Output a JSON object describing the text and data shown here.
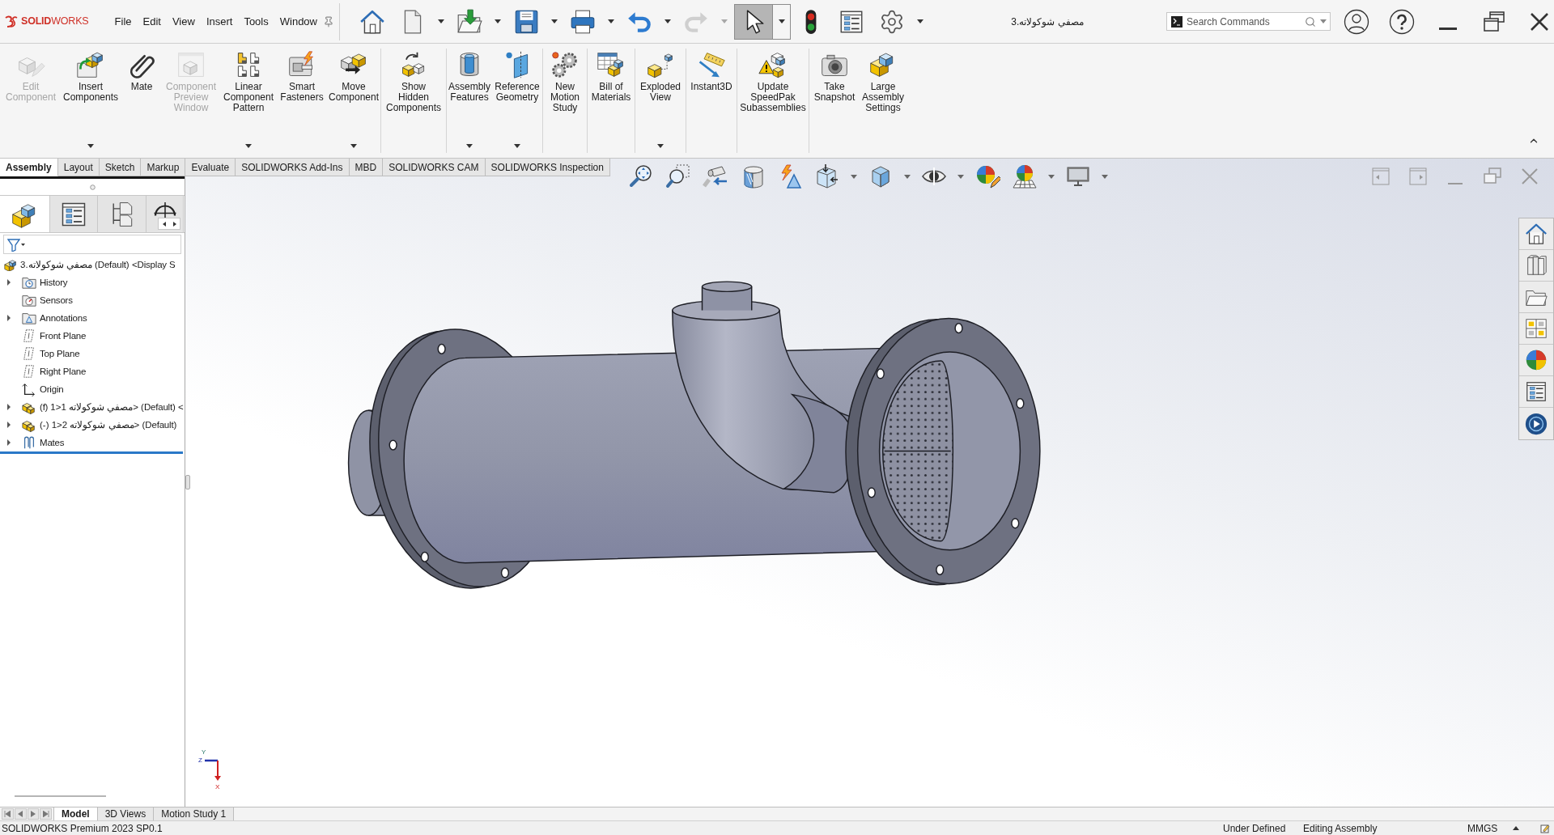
{
  "title_bar": {
    "logo": "**SOLID**WORKS",
    "menu": [
      "File",
      "Edit",
      "View",
      "Insert",
      "Tools",
      "Window"
    ],
    "quick_access": {
      "redo": {
        "disabled": true
      },
      "select": {
        "selected": true
      }
    },
    "document_title": "3.مصفي شوكولاته",
    "search": {
      "placeholder": "Search Commands"
    }
  },
  "ribbon": {
    "groups": [
      [
        {
          "label": "Edit\nComponent",
          "disabled": true,
          "dropdown": false
        },
        {
          "label": "Insert\nComponents",
          "disabled": false,
          "dropdown": true
        },
        {
          "label": "Mate",
          "disabled": false,
          "dropdown": false
        },
        {
          "label": "Component\nPreview\nWindow",
          "disabled": true,
          "dropdown": false
        },
        {
          "label": "Linear\nComponent\nPattern",
          "disabled": false,
          "dropdown": true
        },
        {
          "label": "Smart\nFasteners",
          "disabled": false,
          "dropdown": false
        },
        {
          "label": "Move\nComponent",
          "disabled": false,
          "dropdown": true
        }
      ],
      [
        {
          "label": "Show\nHidden\nComponents",
          "disabled": false,
          "dropdown": false
        }
      ],
      [
        {
          "label": "Assembly\nFeatures",
          "disabled": false,
          "dropdown": true
        },
        {
          "label": "Reference\nGeometry",
          "disabled": false,
          "dropdown": true
        }
      ],
      [
        {
          "label": "New\nMotion\nStudy",
          "disabled": false,
          "dropdown": false
        }
      ],
      [
        {
          "label": "Bill of\nMaterials",
          "disabled": false,
          "dropdown": false
        }
      ],
      [
        {
          "label": "Exploded\nView",
          "disabled": false,
          "dropdown": true
        }
      ],
      [
        {
          "label": "Instant3D",
          "disabled": false,
          "dropdown": false
        }
      ],
      [
        {
          "label": "Update\nSpeedPak\nSubassemblies",
          "disabled": false,
          "dropdown": false
        }
      ],
      [
        {
          "label": "Take\nSnapshot",
          "disabled": false,
          "dropdown": false
        },
        {
          "label": "Large\nAssembly\nSettings",
          "disabled": false,
          "dropdown": false
        }
      ]
    ]
  },
  "command_tabs": [
    {
      "label": "Assembly",
      "selected": true
    },
    {
      "label": "Layout",
      "selected": false
    },
    {
      "label": "Sketch",
      "selected": false
    },
    {
      "label": "Markup",
      "selected": false
    },
    {
      "label": "Evaluate",
      "selected": false
    },
    {
      "label": "SOLIDWORKS Add-Ins",
      "selected": false
    },
    {
      "label": "MBD",
      "selected": false
    },
    {
      "label": "SOLIDWORKS CAM",
      "selected": false
    },
    {
      "label": "SOLIDWORKS Inspection",
      "selected": false
    }
  ],
  "feature_manager": {
    "panel_tabs": [
      {
        "selected": true
      },
      {
        "selected": false
      },
      {
        "selected": false
      },
      {
        "selected": false
      }
    ],
    "tree": {
      "label": "3.مصفي شوكولاته (Default) <Display S",
      "kind": "assembly",
      "children": [
        {
          "label": "History",
          "kind": "history",
          "expanded": false
        },
        {
          "label": "Sensors",
          "kind": "sensors"
        },
        {
          "label": "Annotations",
          "kind": "annotations",
          "expanded": false
        },
        {
          "label": "Front Plane",
          "kind": "plane"
        },
        {
          "label": "Top Plane",
          "kind": "plane"
        },
        {
          "label": "Right Plane",
          "kind": "plane"
        },
        {
          "label": "Origin",
          "kind": "origin"
        },
        {
          "label": "(f) مصفي شوكولاته 1<1> (Default) <",
          "kind": "component",
          "expanded": false
        },
        {
          "label": "(-) مصفي شوكولاته 2<1> (Default)",
          "kind": "component",
          "expanded": false
        },
        {
          "label": "Mates",
          "kind": "mates",
          "expanded": false
        }
      ]
    }
  },
  "viewport": {
    "triad": [
      "Y",
      "Z",
      "X"
    ]
  },
  "bottom_tabs": [
    {
      "label": "Model",
      "selected": true
    },
    {
      "label": "3D Views",
      "selected": false
    },
    {
      "label": "Motion Study 1",
      "selected": false
    }
  ],
  "status_bar": {
    "product": "SOLIDWORKS Premium 2023 SP0.1",
    "fields": [
      "Under Defined",
      "Editing Assembly",
      "MMGS"
    ]
  }
}
